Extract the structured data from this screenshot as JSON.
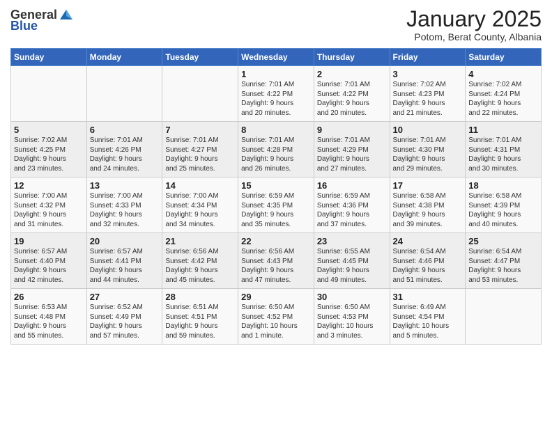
{
  "header": {
    "logo_general": "General",
    "logo_blue": "Blue",
    "month": "January 2025",
    "location": "Potom, Berat County, Albania"
  },
  "weekdays": [
    "Sunday",
    "Monday",
    "Tuesday",
    "Wednesday",
    "Thursday",
    "Friday",
    "Saturday"
  ],
  "weeks": [
    [
      {
        "day": "",
        "info": ""
      },
      {
        "day": "",
        "info": ""
      },
      {
        "day": "",
        "info": ""
      },
      {
        "day": "1",
        "info": "Sunrise: 7:01 AM\nSunset: 4:22 PM\nDaylight: 9 hours\nand 20 minutes."
      },
      {
        "day": "2",
        "info": "Sunrise: 7:01 AM\nSunset: 4:22 PM\nDaylight: 9 hours\nand 20 minutes."
      },
      {
        "day": "3",
        "info": "Sunrise: 7:02 AM\nSunset: 4:23 PM\nDaylight: 9 hours\nand 21 minutes."
      },
      {
        "day": "4",
        "info": "Sunrise: 7:02 AM\nSunset: 4:24 PM\nDaylight: 9 hours\nand 22 minutes."
      }
    ],
    [
      {
        "day": "5",
        "info": "Sunrise: 7:02 AM\nSunset: 4:25 PM\nDaylight: 9 hours\nand 23 minutes."
      },
      {
        "day": "6",
        "info": "Sunrise: 7:01 AM\nSunset: 4:26 PM\nDaylight: 9 hours\nand 24 minutes."
      },
      {
        "day": "7",
        "info": "Sunrise: 7:01 AM\nSunset: 4:27 PM\nDaylight: 9 hours\nand 25 minutes."
      },
      {
        "day": "8",
        "info": "Sunrise: 7:01 AM\nSunset: 4:28 PM\nDaylight: 9 hours\nand 26 minutes."
      },
      {
        "day": "9",
        "info": "Sunrise: 7:01 AM\nSunset: 4:29 PM\nDaylight: 9 hours\nand 27 minutes."
      },
      {
        "day": "10",
        "info": "Sunrise: 7:01 AM\nSunset: 4:30 PM\nDaylight: 9 hours\nand 29 minutes."
      },
      {
        "day": "11",
        "info": "Sunrise: 7:01 AM\nSunset: 4:31 PM\nDaylight: 9 hours\nand 30 minutes."
      }
    ],
    [
      {
        "day": "12",
        "info": "Sunrise: 7:00 AM\nSunset: 4:32 PM\nDaylight: 9 hours\nand 31 minutes."
      },
      {
        "day": "13",
        "info": "Sunrise: 7:00 AM\nSunset: 4:33 PM\nDaylight: 9 hours\nand 32 minutes."
      },
      {
        "day": "14",
        "info": "Sunrise: 7:00 AM\nSunset: 4:34 PM\nDaylight: 9 hours\nand 34 minutes."
      },
      {
        "day": "15",
        "info": "Sunrise: 6:59 AM\nSunset: 4:35 PM\nDaylight: 9 hours\nand 35 minutes."
      },
      {
        "day": "16",
        "info": "Sunrise: 6:59 AM\nSunset: 4:36 PM\nDaylight: 9 hours\nand 37 minutes."
      },
      {
        "day": "17",
        "info": "Sunrise: 6:58 AM\nSunset: 4:38 PM\nDaylight: 9 hours\nand 39 minutes."
      },
      {
        "day": "18",
        "info": "Sunrise: 6:58 AM\nSunset: 4:39 PM\nDaylight: 9 hours\nand 40 minutes."
      }
    ],
    [
      {
        "day": "19",
        "info": "Sunrise: 6:57 AM\nSunset: 4:40 PM\nDaylight: 9 hours\nand 42 minutes."
      },
      {
        "day": "20",
        "info": "Sunrise: 6:57 AM\nSunset: 4:41 PM\nDaylight: 9 hours\nand 44 minutes."
      },
      {
        "day": "21",
        "info": "Sunrise: 6:56 AM\nSunset: 4:42 PM\nDaylight: 9 hours\nand 45 minutes."
      },
      {
        "day": "22",
        "info": "Sunrise: 6:56 AM\nSunset: 4:43 PM\nDaylight: 9 hours\nand 47 minutes."
      },
      {
        "day": "23",
        "info": "Sunrise: 6:55 AM\nSunset: 4:45 PM\nDaylight: 9 hours\nand 49 minutes."
      },
      {
        "day": "24",
        "info": "Sunrise: 6:54 AM\nSunset: 4:46 PM\nDaylight: 9 hours\nand 51 minutes."
      },
      {
        "day": "25",
        "info": "Sunrise: 6:54 AM\nSunset: 4:47 PM\nDaylight: 9 hours\nand 53 minutes."
      }
    ],
    [
      {
        "day": "26",
        "info": "Sunrise: 6:53 AM\nSunset: 4:48 PM\nDaylight: 9 hours\nand 55 minutes."
      },
      {
        "day": "27",
        "info": "Sunrise: 6:52 AM\nSunset: 4:49 PM\nDaylight: 9 hours\nand 57 minutes."
      },
      {
        "day": "28",
        "info": "Sunrise: 6:51 AM\nSunset: 4:51 PM\nDaylight: 9 hours\nand 59 minutes."
      },
      {
        "day": "29",
        "info": "Sunrise: 6:50 AM\nSunset: 4:52 PM\nDaylight: 10 hours\nand 1 minute."
      },
      {
        "day": "30",
        "info": "Sunrise: 6:50 AM\nSunset: 4:53 PM\nDaylight: 10 hours\nand 3 minutes."
      },
      {
        "day": "31",
        "info": "Sunrise: 6:49 AM\nSunset: 4:54 PM\nDaylight: 10 hours\nand 5 minutes."
      },
      {
        "day": "",
        "info": ""
      }
    ]
  ]
}
